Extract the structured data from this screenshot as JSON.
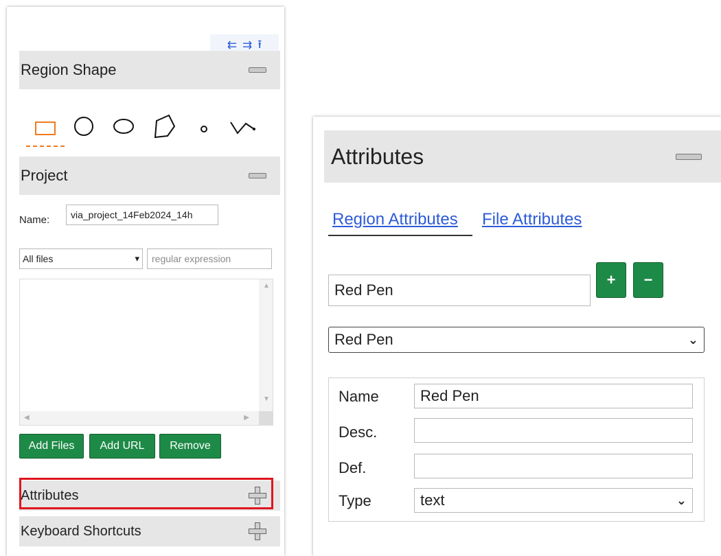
{
  "left_panel": {
    "nav_arrows": [
      "⇇",
      "⇉",
      "⭱"
    ],
    "region_shape": {
      "title": "Region Shape",
      "shapes": [
        "rectangle",
        "circle",
        "ellipse",
        "polygon",
        "point",
        "polyline"
      ],
      "selected": "rectangle",
      "accent_color": "#f07a1e"
    },
    "project": {
      "title": "Project",
      "name_label": "Name:",
      "name_value": "via_project_14Feb2024_14h",
      "file_filter_selected": "All files",
      "regex_placeholder": "regular expression",
      "buttons": {
        "add_files": "Add Files",
        "add_url": "Add URL",
        "remove": "Remove"
      }
    },
    "attributes_title": "Attributes",
    "keyboard_shortcuts_title": "Keyboard Shortcuts",
    "highlight_color": "#e0141e",
    "button_color": "#1e8a47"
  },
  "right_panel": {
    "title": "Attributes",
    "tabs": {
      "region": "Region Attributes",
      "file": "File Attributes"
    },
    "attribute_input_value": "Red Pen",
    "add_label": "+",
    "remove_label": "−",
    "attribute_select_value": "Red Pen",
    "fields": {
      "name_label": "Name",
      "name_value": "Red Pen",
      "desc_label": "Desc.",
      "desc_value": "",
      "def_label": "Def.",
      "def_value": "",
      "type_label": "Type",
      "type_value": "text"
    },
    "link_color": "#2d5bd8"
  }
}
